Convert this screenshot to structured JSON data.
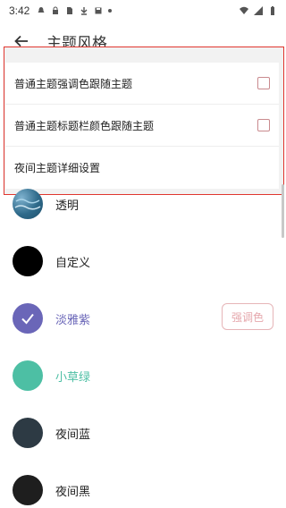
{
  "status": {
    "time": "3:42"
  },
  "app_bar": {
    "title": "主题风格"
  },
  "settings": [
    {
      "label": "普通主题强调色跟随主题",
      "has_checkbox": true
    },
    {
      "label": "普通主题标题栏颜色跟随主题",
      "has_checkbox": true
    },
    {
      "label": "夜间主题详细设置",
      "has_checkbox": false
    }
  ],
  "themes": [
    {
      "name": "透明",
      "color": "#3a6f8f",
      "name_color": "#222222",
      "selected": false
    },
    {
      "name": "自定义",
      "color": "#000000",
      "name_color": "#222222",
      "selected": false
    },
    {
      "name": "淡雅紫",
      "color": "#6a66b8",
      "name_color": "#6a66b8",
      "selected": true
    },
    {
      "name": "小草绿",
      "color": "#4dbfa4",
      "name_color": "#4dbfa4",
      "selected": false
    },
    {
      "name": "夜间蓝",
      "color": "#2d3a44",
      "name_color": "#222222",
      "selected": false
    },
    {
      "name": "夜间黑",
      "color": "#1e1e1e",
      "name_color": "#222222",
      "selected": false
    }
  ],
  "accent_button": {
    "label": "强调色"
  },
  "colors": {
    "highlight_border": "#e0362f",
    "checkbox_border": "#c98a8e"
  }
}
